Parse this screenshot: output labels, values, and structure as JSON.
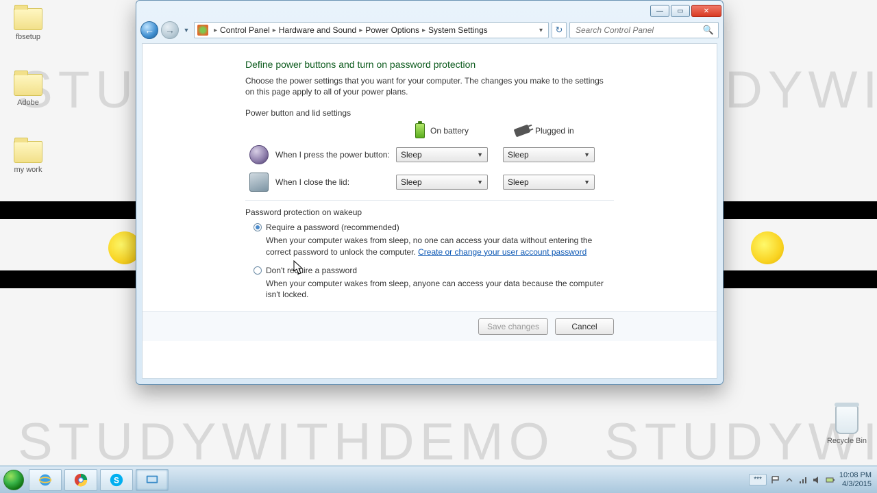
{
  "desktop": {
    "watermark": "STUDYWITHDEMO",
    "icons": [
      {
        "label": "fbsetup"
      },
      {
        "label": "Adobe"
      },
      {
        "label": "my work"
      }
    ],
    "recycle_label": "Recycle Bin"
  },
  "window": {
    "breadcrumb": {
      "root": "Control Panel",
      "l2": "Hardware and Sound",
      "l3": "Power Options",
      "l4": "System Settings"
    },
    "search_placeholder": "Search Control Panel",
    "heading": "Define power buttons and turn on password protection",
    "intro": "Choose the power settings that you want for your computer. The changes you make to the settings on this page apply to all of your power plans.",
    "section1_title": "Power button and lid settings",
    "col_battery": "On battery",
    "col_plugged": "Plugged in",
    "row_power_label": "When I press the power button:",
    "row_lid_label": "When I close the lid:",
    "dropdowns": {
      "power_battery": "Sleep",
      "power_plugged": "Sleep",
      "lid_battery": "Sleep",
      "lid_plugged": "Sleep"
    },
    "section2_title": "Password protection on wakeup",
    "opt1_label": "Require a password (recommended)",
    "opt1_desc_a": "When your computer wakes from sleep, no one can access your data without entering the correct password to unlock the computer. ",
    "opt1_link": "Create or change your user account password",
    "opt2_label": "Don't require a password",
    "opt2_desc": "When your computer wakes from sleep, anyone can access your data because the computer isn't locked.",
    "btn_save": "Save changes",
    "btn_cancel": "Cancel"
  },
  "taskbar": {
    "lang": "***",
    "time": "10:08 PM",
    "date": "4/3/2015"
  }
}
